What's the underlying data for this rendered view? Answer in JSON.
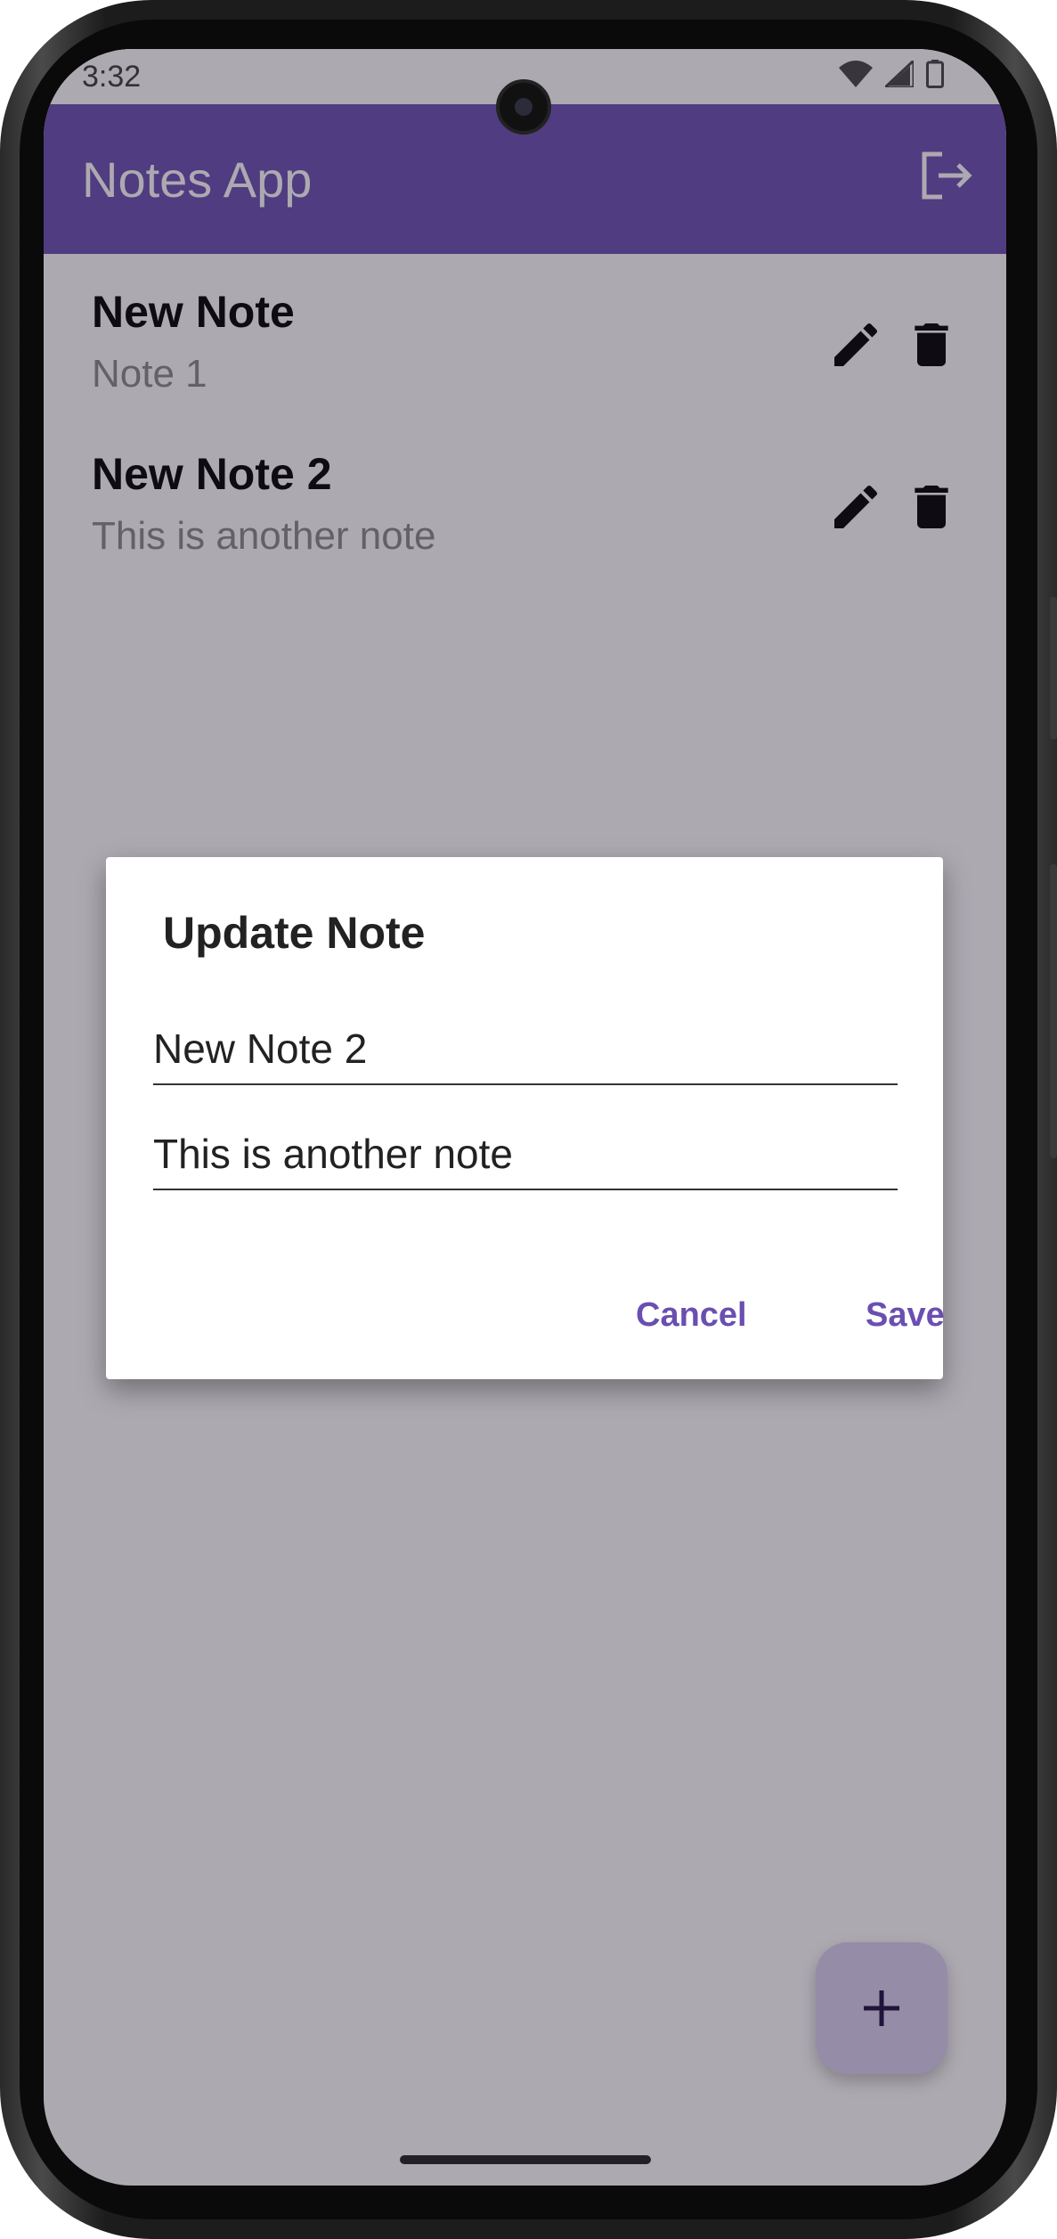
{
  "status_bar": {
    "time": "3:32"
  },
  "app_bar": {
    "title": "Notes App",
    "logout_icon": "logout-icon"
  },
  "notes": [
    {
      "title": "New Note",
      "body": "Note 1"
    },
    {
      "title": "New Note 2",
      "body": "This is another note"
    }
  ],
  "dialog": {
    "title": "Update Note",
    "title_field_value": "New Note 2",
    "body_field_value": "This is another note",
    "cancel_label": "Cancel",
    "save_label": "Save"
  },
  "fab": {
    "icon": "add-icon"
  },
  "colors": {
    "accent": "#6a4fb0",
    "fab_bg": "#d9d0f0"
  }
}
